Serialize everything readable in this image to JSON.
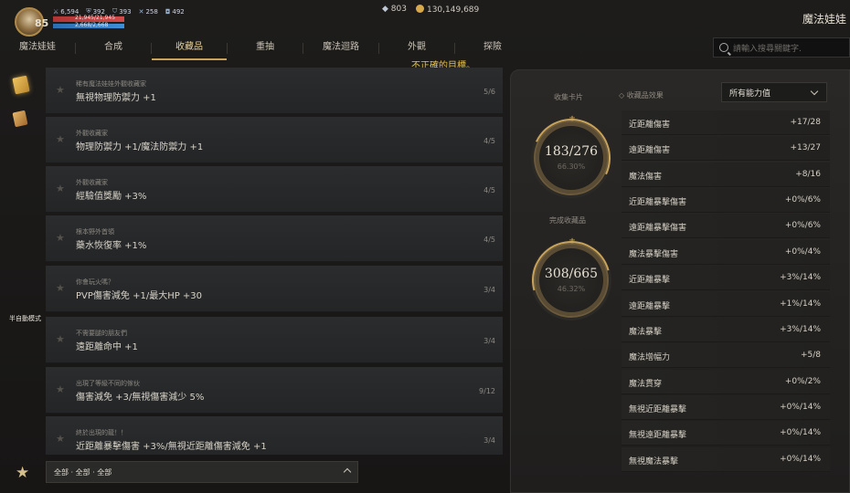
{
  "topbar": {
    "level": "85",
    "stats": [
      "6,594",
      "392",
      "393",
      "258",
      "492"
    ],
    "hp": "21,945/21,945",
    "mp": "2,668/2,668",
    "gems": "803",
    "gold": "130,149,689",
    "window_title": "魔法娃娃"
  },
  "tabs": [
    "魔法娃娃",
    "合成",
    "收藏品",
    "重抽",
    "魔法迴路",
    "外觀",
    "探險"
  ],
  "active_tab": "收藏品",
  "search": {
    "placeholder": "請輸入搜尋關鍵字."
  },
  "warning": "不正確的目標。",
  "left_rail": {
    "auto_mode": "半自動模式"
  },
  "collections": [
    {
      "title": "稀有魔法娃娃外觀收藏家",
      "desc": "無視物理防禦力 +1",
      "progress": "5/6"
    },
    {
      "title": "外觀收藏家",
      "desc": "物理防禦力 +1/魔法防禦力 +1",
      "progress": "4/5"
    },
    {
      "title": "外觀收藏家",
      "desc": "經驗值獎勵 +3%",
      "progress": "4/5"
    },
    {
      "title": "根本野外首領",
      "desc": "藥水恢復率 +1%",
      "progress": "4/5"
    },
    {
      "title": "你會玩火嗎？",
      "desc": "PVP傷害減免 +1/最大HP +30",
      "progress": "3/4"
    },
    {
      "title": "不需要腿的朋友們",
      "desc": "遠距離命中 +1",
      "progress": "3/4"
    },
    {
      "title": "出現了等級不同的傢伙",
      "desc": "傷害減免 +3/無視傷害減少 5%",
      "progress": "9/12"
    },
    {
      "title": "終於出現的龍！！",
      "desc": "近距離暴擊傷害 +3%/無視近距離傷害減免 +1",
      "progress": "3/4"
    }
  ],
  "filter": {
    "label": "全部 · 全部 · 全部"
  },
  "summary": {
    "cards_label": "收集卡片",
    "cards_value": "183/276",
    "cards_pct": "66.30%",
    "completed_label": "完成收藏品",
    "completed_value": "308/665",
    "completed_pct": "46.32%"
  },
  "effects": {
    "title": "收藏品效果",
    "dropdown": "所有能力值",
    "items": [
      {
        "name": "近距離傷害",
        "value": "+17/28"
      },
      {
        "name": "遠距離傷害",
        "value": "+13/27"
      },
      {
        "name": "魔法傷害",
        "value": "+8/16"
      },
      {
        "name": "近距離暴擊傷害",
        "value": "+0%/6%"
      },
      {
        "name": "遠距離暴擊傷害",
        "value": "+0%/6%"
      },
      {
        "name": "魔法暴擊傷害",
        "value": "+0%/4%"
      },
      {
        "name": "近距離暴擊",
        "value": "+3%/14%"
      },
      {
        "name": "遠距離暴擊",
        "value": "+1%/14%"
      },
      {
        "name": "魔法暴擊",
        "value": "+3%/14%"
      },
      {
        "name": "魔法增幅力",
        "value": "+5/8"
      },
      {
        "name": "魔法貫穿",
        "value": "+0%/2%"
      },
      {
        "name": "無視近距離暴擊",
        "value": "+0%/14%"
      },
      {
        "name": "無視遠距離暴擊",
        "value": "+0%/14%"
      },
      {
        "name": "無視魔法暴擊",
        "value": "+0%/14%"
      }
    ]
  }
}
